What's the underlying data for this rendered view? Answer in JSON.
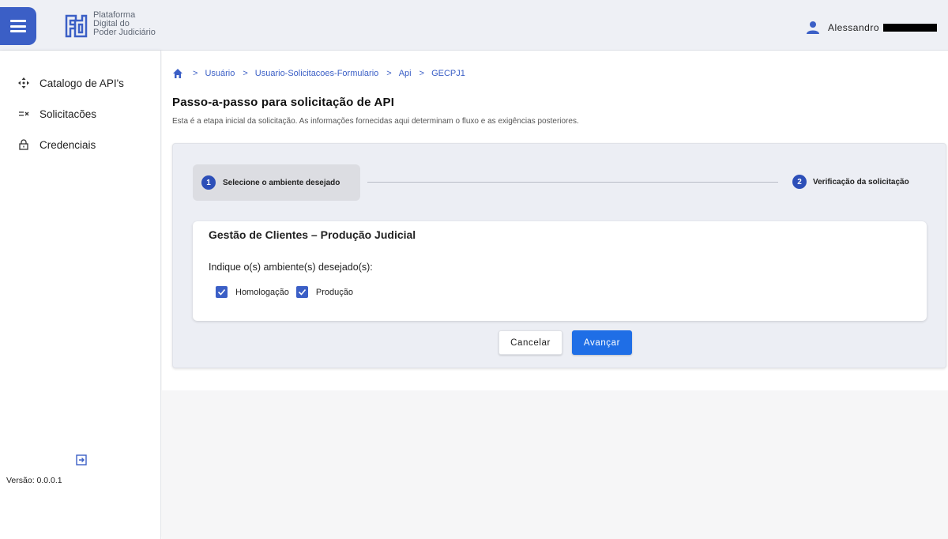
{
  "header": {
    "logo_lines": [
      "Plataforma",
      "Digital do",
      "Poder Judiciário"
    ],
    "user_name": "Alessandro"
  },
  "sidebar": {
    "items": [
      {
        "label": "Catalogo de API's",
        "icon": "move-arrows-icon"
      },
      {
        "label": "Solicitacões",
        "icon": "list-icon"
      },
      {
        "label": "Credenciais",
        "icon": "lock-icon"
      }
    ],
    "version": "Versão: 0.0.0.1"
  },
  "breadcrumb": {
    "items": [
      "Usuário",
      "Usuario-Solicitacoes-Formulario",
      "Api",
      "GECPJ1"
    ]
  },
  "page": {
    "title": "Passo-a-passo para solicitação de API",
    "description": "Esta é a etapa inicial da solicitação. As informações fornecidas aqui determinam o fluxo e as exigências posteriores."
  },
  "stepper": {
    "steps": [
      {
        "number": "1",
        "label": "Selecione o ambiente desejado",
        "active": true
      },
      {
        "number": "2",
        "label": "Verificação da solicitação",
        "active": false
      }
    ]
  },
  "form": {
    "title": "Gestão de Clientes – Produção Judicial",
    "question": "Indique o(s) ambiente(s) desejado(s):",
    "options": [
      {
        "label": "Homologação",
        "checked": true
      },
      {
        "label": "Produção",
        "checked": true
      }
    ]
  },
  "actions": {
    "cancel_label": "Cancelar",
    "next_label": "Avançar"
  },
  "colors": {
    "primary": "#3b5fc6",
    "button_primary": "#1f6ee6"
  }
}
